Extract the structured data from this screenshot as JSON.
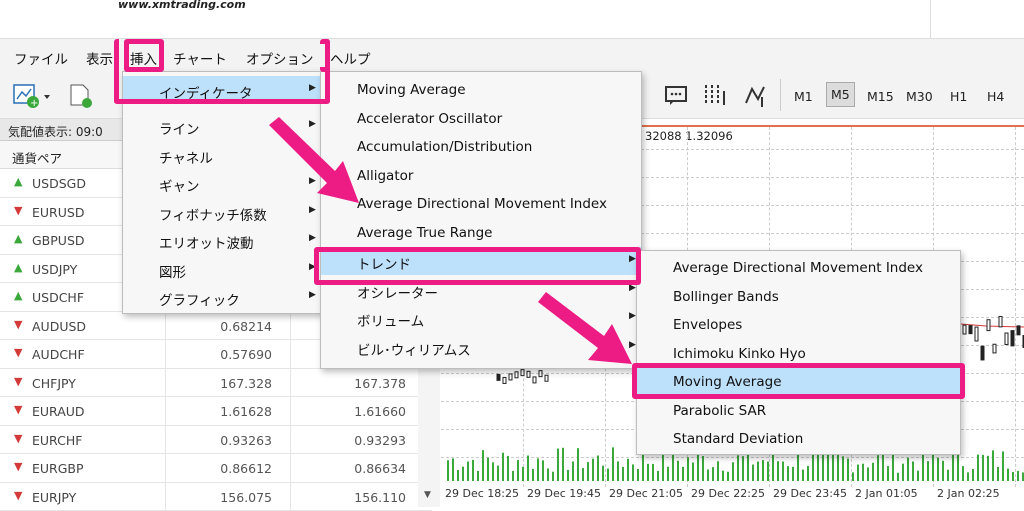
{
  "site_url": "www.xmtrading.com",
  "menubar": [
    "ファイル",
    "表示",
    "挿入",
    "チャート",
    "オプション",
    "ヘルプ"
  ],
  "timeframes": [
    "M1",
    "M5",
    "M15",
    "M30",
    "H1",
    "H4"
  ],
  "selected_timeframe": "M5",
  "market_watch": {
    "header": "気配値表示: 09:0",
    "col_symbol": "通貨ペア",
    "rows": [
      {
        "symbol": "USDSGD",
        "dir": "up",
        "bid": "",
        "ask": ""
      },
      {
        "symbol": "EURUSD",
        "dir": "down",
        "bid": "",
        "ask": ""
      },
      {
        "symbol": "GBPUSD",
        "dir": "up",
        "bid": "",
        "ask": ""
      },
      {
        "symbol": "USDJPY",
        "dir": "up",
        "bid": "",
        "ask": ""
      },
      {
        "symbol": "USDCHF",
        "dir": "up",
        "bid": "",
        "ask": ""
      },
      {
        "symbol": "AUDUSD",
        "dir": "down",
        "bid": "0.68214",
        "ask": ""
      },
      {
        "symbol": "AUDCHF",
        "dir": "down",
        "bid": "0.57690",
        "ask": ""
      },
      {
        "symbol": "CHFJPY",
        "dir": "down",
        "bid": "167.328",
        "ask": "167.378"
      },
      {
        "symbol": "EURAUD",
        "dir": "down",
        "bid": "1.61628",
        "ask": "1.61660"
      },
      {
        "symbol": "EURCHF",
        "dir": "down",
        "bid": "0.93263",
        "ask": "0.93293"
      },
      {
        "symbol": "EURGBP",
        "dir": "down",
        "bid": "0.86612",
        "ask": "0.86634"
      },
      {
        "symbol": "EURJPY",
        "dir": "down",
        "bid": "156.075",
        "ask": "156.110"
      }
    ]
  },
  "chart": {
    "price_text": "32088 1.32096",
    "x_ticks": [
      "29 Dec 18:25",
      "29 Dec 19:45",
      "29 Dec 21:05",
      "29 Dec 22:25",
      "29 Dec 23:45",
      "2 Jan 01:05",
      "2 Jan 02:25"
    ]
  },
  "menu_insert": [
    "インディケータ",
    "ライン",
    "チャネル",
    "ギャン",
    "フィボナッチ係数",
    "エリオット波動",
    "図形",
    "グラフィック"
  ],
  "menu_indicators": [
    "Moving Average",
    "Accelerator Oscillator",
    "Accumulation/Distribution",
    "Alligator",
    "Average Directional Movement Index",
    "Average True Range",
    "トレンド",
    "オシレーター",
    "ボリューム",
    "ビル･ウィリアムス"
  ],
  "menu_trend": [
    "Average Directional Movement Index",
    "Bollinger Bands",
    "Envelopes",
    "Ichimoku Kinko Hyo",
    "Moving Average",
    "Parabolic SAR",
    "Standard Deviation"
  ],
  "colors": {
    "highlight": "#bde0fb",
    "annotation": "#ec1c84",
    "up": "#3aa83a",
    "down": "#d43a3a"
  }
}
